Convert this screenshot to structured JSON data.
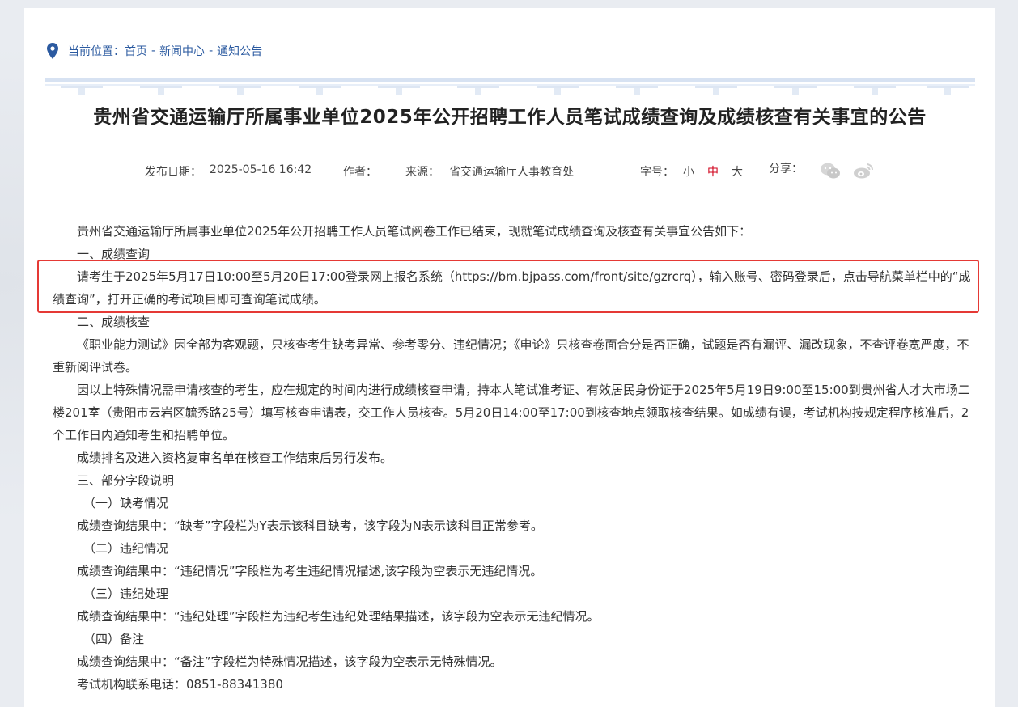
{
  "breadcrumb": {
    "label": "当前位置：",
    "items": [
      "首页",
      "新闻中心",
      "通知公告"
    ],
    "separator": "-"
  },
  "article": {
    "title": "贵州省交通运输厅所属事业单位2025年公开招聘工作人员笔试成绩查询及成绩核查有关事宜的公告",
    "meta": {
      "date_label": "发布日期：",
      "date": "2025-05-16 16:42",
      "author_label": "作者：",
      "source_label": "来源：",
      "source": "省交通运输厅人事教育处",
      "font_label": "字号：",
      "font_small": "小",
      "font_medium": "中",
      "font_large": "大",
      "share_label": "分享："
    },
    "paragraphs": [
      "贵州省交通运输厅所属事业单位2025年公开招聘工作人员笔试阅卷工作已结束，现就笔试成绩查询及核查有关事宜公告如下：",
      "一、成绩查询",
      "请考生于2025年5月17日10:00至5月20日17:00登录网上报名系统（https://bm.bjpass.com/front/site/gzrcrq），输入账号、密码登录后，点击导航菜单栏中的“成绩查询”，打开正确的考试项目即可查询笔试成绩。",
      "二、成绩核查",
      "《职业能力测试》因全部为客观题，只核查考生缺考异常、参考零分、违纪情况；《申论》只核查卷面合分是否正确，试题是否有漏评、漏改现象，不查评卷宽严度，不重新阅评试卷。",
      "因以上特殊情况需申请核查的考生，应在规定的时间内进行成绩核查申请，持本人笔试准考证、有效居民身份证于2025年5月19日9:00至15:00到贵州省人才大市场二楼201室（贵阳市云岩区毓秀路25号）填写核查申请表，交工作人员核查。5月20日14:00至17:00到核查地点领取核查结果。如成绩有误，考试机构按规定程序核准后，2个工作日内通知考生和招聘单位。",
      "成绩排名及进入资格复审名单在核查工作结束后另行发布。",
      "三、部分字段说明",
      "（一）缺考情况",
      "成绩查询结果中：“缺考”字段栏为Y表示该科目缺考，该字段为N表示该科目正常参考。",
      "（二）违纪情况",
      "成绩查询结果中：“违纪情况”字段栏为考生违纪情况描述,该字段为空表示无违纪情况。",
      "（三）违纪处理",
      "成绩查询结果中：“违纪处理”字段栏为违纪考生违纪处理结果描述，该字段为空表示无违纪情况。",
      "（四）备注",
      "成绩查询结果中：“备注”字段栏为特殊情况描述，该字段为空表示无特殊情况。",
      "考试机构联系电话：0851-88341380"
    ]
  },
  "icons": {
    "location": "location-pin-icon",
    "wechat": "wechat-icon",
    "weibo": "weibo-icon"
  },
  "colors": {
    "link": "#2b5aa0",
    "active_font": "#d0021b",
    "highlight_border": "#e53935"
  }
}
